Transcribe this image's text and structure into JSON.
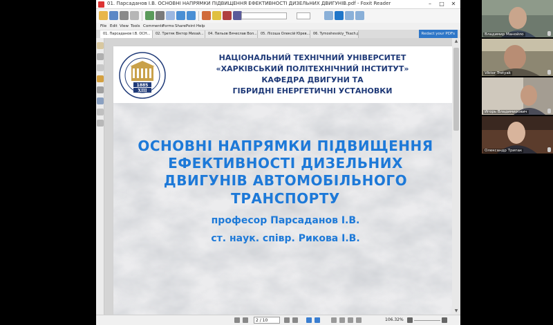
{
  "reader": {
    "window_title": "01. Парсаданов І.В. ОСНОВНІ НАПРЯМКИ ПІДВИЩЕННЯ ЕФЕКТИВНОСТІ ДИЗЕЛЬНИХ ДВИГУНІВ.pdf - Foxit Reader",
    "minimize": "–",
    "maximize": "□",
    "close": "✕",
    "menu": [
      "File",
      "Edit",
      "View",
      "Tools",
      "Comments",
      "Forms",
      "SharePoint",
      "Help"
    ],
    "tabs": [
      "01. Парсаданов І.В. ОСН...",
      "02. Третяк Віктор Михай...",
      "04. Пильов Вячеслав Вол...",
      "05. Лісоша Олексій Юрев...",
      "06. Tymoshevskiy_Tkach.pdf"
    ],
    "promo": "Redact your PDFs",
    "page_field": "2 / 10",
    "zoom": "106.32%"
  },
  "slide": {
    "logo_year": "1885",
    "logo_abbr": "ХПІ",
    "header_lines": [
      "НАЦІОНАЛЬНИЙ ТЕХНІЧНИЙ УНІВЕРСИТЕТ",
      "«ХАРКІВСЬКИЙ ПОЛІТЕХНІЧНИЙ ІНСТИТУТ»",
      "КАФЕДРА ДВИГУНИ ТА",
      "ГІБРИДНІ ЕНЕРГЕТИЧНІ УСТАНОВКИ"
    ],
    "title_lines": [
      "ОСНОВНІ НАПРЯМКИ ПІДВИЩЕННЯ",
      "ЕФЕКТИВНОСТІ ДИЗЕЛЬНИХ",
      "ДВИГУНІВ АВТОМОБІЛЬНОГО",
      "ТРАНСПОРТУ"
    ],
    "authors": [
      "професор  Парсаданов І.В.",
      "ст. наук. співр. Рикова І.В."
    ]
  },
  "participants": [
    {
      "name": "Владимир Манойло",
      "bg": "#6e7a6e"
    },
    {
      "name": "Viktor Tretyak",
      "bg": "#8d8772"
    },
    {
      "name": "Игорь Владимирович",
      "bg": "#a49d92"
    },
    {
      "name": "Олександр Трипак",
      "bg": "#5b3c2c"
    }
  ]
}
